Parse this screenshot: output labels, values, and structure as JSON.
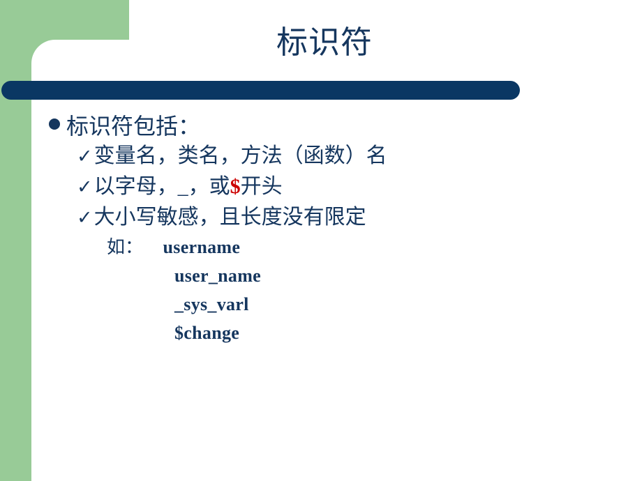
{
  "slide": {
    "title": "标识符",
    "theme": {
      "green": "#98cb97",
      "navy": "#0a3763",
      "text_navy": "#15365e",
      "accent_red": "#cc0000",
      "background": "#ffffff"
    },
    "bullets": {
      "level1": {
        "marker": "filled-circle-bullet",
        "text": "标识符包括："
      },
      "level2": [
        {
          "marker": "checkmark-bullet",
          "text": "变量名，类名，方法（函数）名"
        },
        {
          "marker": "checkmark-bullet",
          "text_before": "以字母，_，或",
          "accent": "$",
          "text_after": "开头"
        },
        {
          "marker": "checkmark-bullet",
          "text": "大小写敏感，且长度没有限定"
        }
      ],
      "example": {
        "label": "如：",
        "items": [
          "username",
          "user_name",
          "_sys_varl",
          "$change"
        ]
      }
    },
    "icons": {
      "checkmark": "✓"
    }
  }
}
